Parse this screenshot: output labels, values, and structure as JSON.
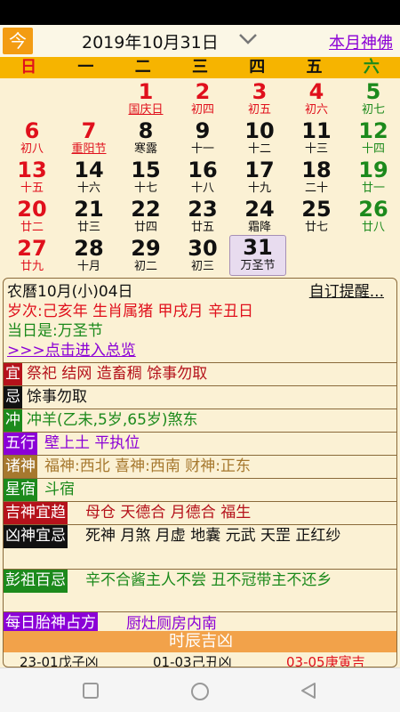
{
  "header": {
    "today_label": "今",
    "date": "2019年10月31日",
    "month_link": "本月神佛"
  },
  "weekdays": [
    "日",
    "一",
    "二",
    "三",
    "四",
    "五",
    "六"
  ],
  "days": [
    {
      "n": "1",
      "s": "国庆日"
    },
    {
      "n": "2",
      "s": "初四"
    },
    {
      "n": "3",
      "s": "初五"
    },
    {
      "n": "4",
      "s": "初六"
    },
    {
      "n": "5",
      "s": "初七"
    },
    {
      "n": "6",
      "s": "初八"
    },
    {
      "n": "7",
      "s": "重阳节"
    },
    {
      "n": "8",
      "s": "寒露"
    },
    {
      "n": "9",
      "s": "十一"
    },
    {
      "n": "10",
      "s": "十二"
    },
    {
      "n": "11",
      "s": "十三"
    },
    {
      "n": "12",
      "s": "十四"
    },
    {
      "n": "13",
      "s": "十五"
    },
    {
      "n": "14",
      "s": "十六"
    },
    {
      "n": "15",
      "s": "十七"
    },
    {
      "n": "16",
      "s": "十八"
    },
    {
      "n": "17",
      "s": "十九"
    },
    {
      "n": "18",
      "s": "二十"
    },
    {
      "n": "19",
      "s": "廿一"
    },
    {
      "n": "20",
      "s": "廿二"
    },
    {
      "n": "21",
      "s": "廿三"
    },
    {
      "n": "22",
      "s": "廿四"
    },
    {
      "n": "23",
      "s": "廿五"
    },
    {
      "n": "24",
      "s": "霜降"
    },
    {
      "n": "25",
      "s": "廿七"
    },
    {
      "n": "26",
      "s": "廿八"
    },
    {
      "n": "27",
      "s": "廿九"
    },
    {
      "n": "28",
      "s": "十月"
    },
    {
      "n": "29",
      "s": "初二"
    },
    {
      "n": "30",
      "s": "初三"
    },
    {
      "n": "31",
      "s": "万圣节"
    }
  ],
  "info": {
    "lunar": "农曆10月(小)04日",
    "custom_reminder": "自订提醒...",
    "ganzhi": "岁次:己亥年 生肖属猪 甲戌月 辛丑日",
    "festival": "当日是:万圣节",
    "overview_link": ">>>点击进入总览",
    "rows": [
      {
        "tag": "宜",
        "value": "祭祀 结网 造畜稠 馀事勿取"
      },
      {
        "tag": "忌",
        "value": "馀事勿取"
      },
      {
        "tag": "冲",
        "value": "冲羊(乙未,5岁,65岁)煞东"
      },
      {
        "tag": "五行",
        "value": "壁上土 平执位"
      },
      {
        "tag": "诸神",
        "value": "福神:西北 喜神:西南 财神:正东"
      },
      {
        "tag": "星宿",
        "value": "斗宿"
      },
      {
        "tag": "吉神宜趋",
        "value": "母仓 天德合 月德合 福生"
      },
      {
        "tag": "凶神宜忌",
        "value": "死神 月煞 月虚 地囊 元武 天罡 正红纱"
      },
      {
        "tag": "彭祖百忌",
        "value": "辛不合酱主人不尝 丑不冠带主不还乡"
      },
      {
        "tag": "每日胎神占方",
        "value": "厨灶厕房内南"
      }
    ],
    "shichen_title": "时辰吉凶",
    "shichen": [
      "23-01戊子凶",
      "01-03己丑凶",
      "03-05庚寅吉"
    ]
  },
  "colors": {
    "red": "#e0101c",
    "green": "#1c8a1c",
    "purple": "#8b00d6",
    "gold": "#f6b400"
  }
}
